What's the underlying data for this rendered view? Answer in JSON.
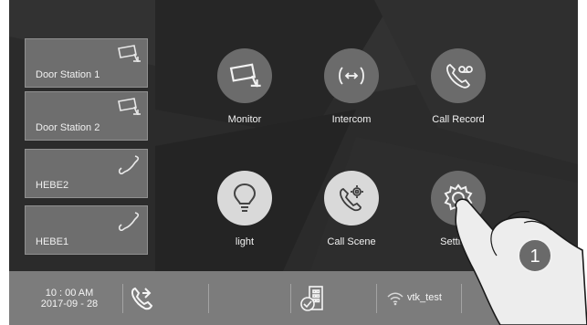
{
  "side_items": [
    {
      "label": "Door Station 1",
      "icon": "camera-icon"
    },
    {
      "label": "Door Station 2",
      "icon": "camera-icon"
    },
    {
      "label": "HEBE2",
      "icon": "phone-icon"
    },
    {
      "label": "HEBE1",
      "icon": "phone-icon"
    }
  ],
  "apps": [
    {
      "label": "Monitor",
      "icon": "camera-icon"
    },
    {
      "label": "Intercom",
      "icon": "intercom-icon"
    },
    {
      "label": "Call Record",
      "icon": "voicemail-icon"
    },
    {
      "label": "light",
      "icon": "bulb-icon"
    },
    {
      "label": "Call Scene",
      "icon": "phone-gear-icon"
    },
    {
      "label": "Settings",
      "icon": "gear-icon"
    }
  ],
  "status_bar": {
    "time": "10 : 00  AM",
    "date": "2017-09 - 28",
    "wifi_ssid": "vtk_test"
  },
  "callout_number": "1",
  "colors": {
    "screen_bg": "#2b2b2b",
    "tile_bg": "#6e6e6e",
    "bar_bg": "#7c7c7c",
    "icon_dark": "#6b6b6b",
    "icon_light": "#d9d9d9"
  }
}
